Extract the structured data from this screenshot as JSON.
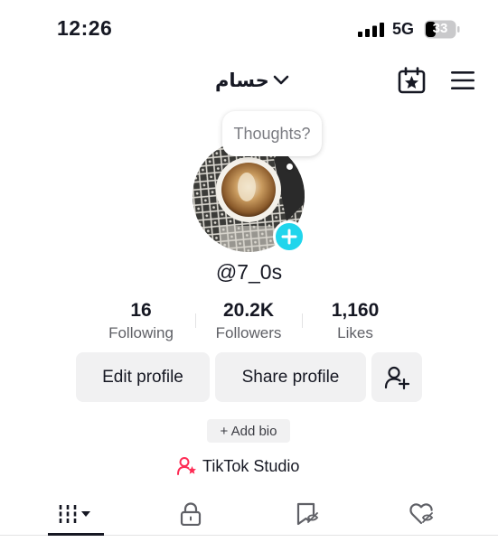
{
  "status_bar": {
    "time": "12:26",
    "network": "5G",
    "battery": "33"
  },
  "header": {
    "username": "حسام"
  },
  "thoughts": {
    "placeholder": "Thoughts?"
  },
  "profile": {
    "handle": "@7_0s"
  },
  "stats": [
    {
      "value": "16",
      "label": "Following"
    },
    {
      "value": "20.2K",
      "label": "Followers"
    },
    {
      "value": "1,160",
      "label": "Likes"
    }
  ],
  "buttons": {
    "edit_profile": "Edit profile",
    "share_profile": "Share profile"
  },
  "bio": {
    "add_bio": "+ Add bio"
  },
  "studio": {
    "label": "TikTok Studio"
  },
  "colors": {
    "accent": "#20d5ec",
    "studio_icon": "#fe2c55",
    "text": "#161823",
    "button_bg": "#f1f1f2"
  },
  "tabs": [
    {
      "icon": "grid-icon",
      "selected": true
    },
    {
      "icon": "lock-icon",
      "selected": false
    },
    {
      "icon": "bookmark-icon",
      "selected": false
    },
    {
      "icon": "liked-heart-icon",
      "selected": false
    }
  ]
}
